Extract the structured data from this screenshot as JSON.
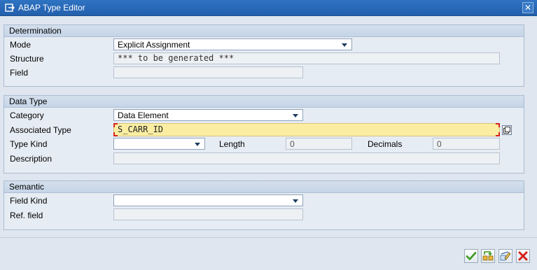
{
  "window": {
    "title": "ABAP Type Editor",
    "close_glyph": "✕",
    "icon": "editor-window-icon"
  },
  "determination": {
    "header": "Determination",
    "mode_label": "Mode",
    "mode_value": "Explicit Assignment",
    "structure_label": "Structure",
    "structure_value": "*** to be generated ***",
    "field_label": "Field",
    "field_value": ""
  },
  "data_type": {
    "header": "Data Type",
    "category_label": "Category",
    "category_value": "Data Element",
    "associated_type_label": "Associated Type",
    "associated_type_value": "S_CARR_ID",
    "type_kind_label": "Type Kind",
    "type_kind_value": "",
    "length_label": "Length",
    "length_value": "0",
    "decimals_label": "Decimals",
    "decimals_value": "0",
    "description_label": "Description",
    "description_value": ""
  },
  "semantic": {
    "header": "Semantic",
    "field_kind_label": "Field Kind",
    "field_kind_value": "",
    "ref_field_label": "Ref. field",
    "ref_field_value": ""
  },
  "toolbar": {
    "confirm": "check-icon",
    "transfer": "transfer-icon",
    "edit": "edit-icon",
    "cancel": "cancel-icon"
  },
  "colors": {
    "titlebar": "#2666b3",
    "background": "#dfe6ef",
    "active_field": "#fbeea3",
    "required_marker": "#d4231c"
  }
}
